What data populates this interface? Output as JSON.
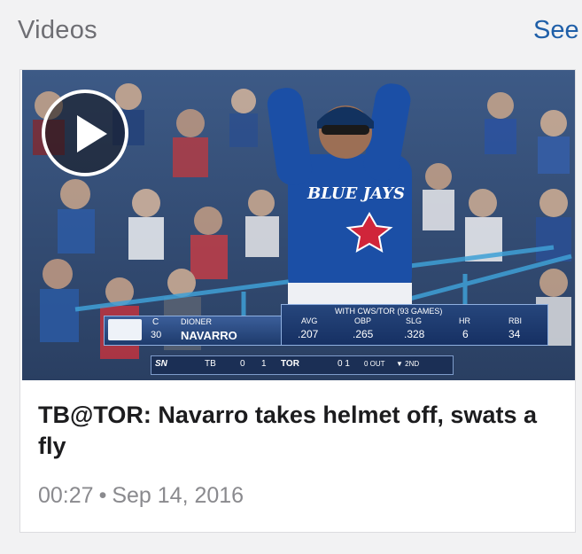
{
  "section": {
    "title": "Videos",
    "see_label": "See"
  },
  "video": {
    "title": "TB@TOR: Navarro takes helmet off, swats a fly",
    "duration": "00:27",
    "separator": "•",
    "date": "Sep 14, 2016"
  },
  "broadcast": {
    "position": "C",
    "number": "30",
    "first_name": "DIONER",
    "last_name": "NAVARRO",
    "team_script": "BLUE JAYS",
    "stats_header": "WITH CWS/TOR (93 GAMES)",
    "stat_labels": [
      "AVG",
      "OBP",
      "SLG",
      "HR",
      "RBI"
    ],
    "stat_values": [
      ".207",
      ".265",
      ".328",
      "6",
      "34"
    ],
    "network": "SN",
    "away_team": "TB",
    "away_score": "0",
    "home_team": "TOR",
    "home_score": "1",
    "count": "0 1",
    "outs": "0 OUT",
    "inning": "▼ 2ND"
  },
  "colors": {
    "link": "#1f5fa8",
    "title_text": "#1c1c1e",
    "meta_text": "#8a8a8e",
    "jays_blue": "#1b4fa6"
  },
  "icons": {
    "play": "play-icon"
  }
}
